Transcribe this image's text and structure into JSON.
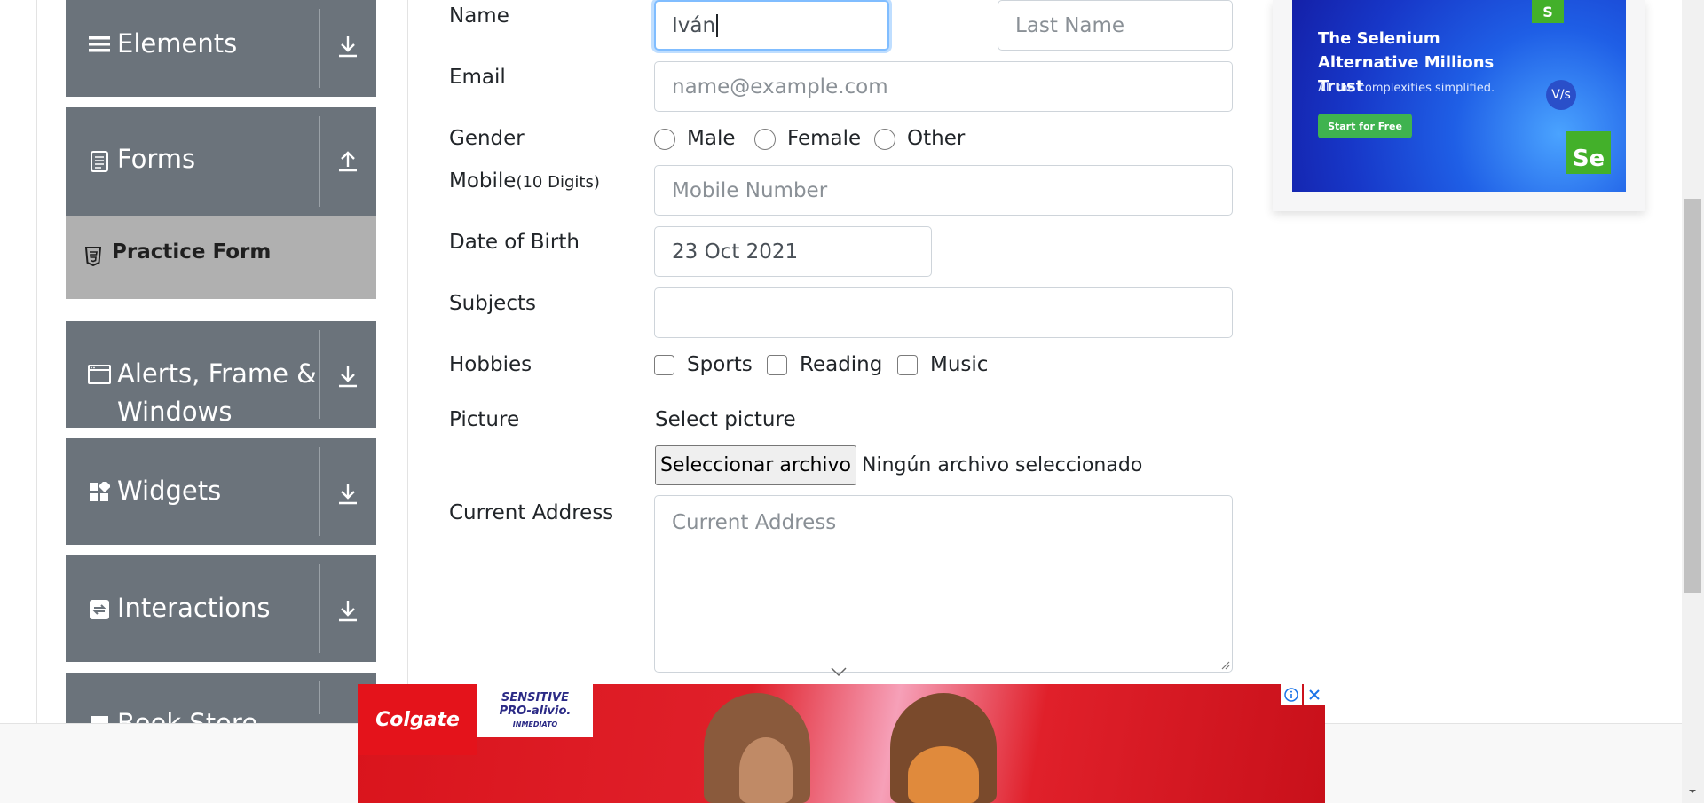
{
  "sidebar": {
    "groups": [
      {
        "label": "Elements",
        "icon": "hamburger-icon",
        "arrow": "download-arrow-icon"
      },
      {
        "label": "Forms",
        "icon": "document-icon",
        "arrow": "upload-arrow-icon"
      },
      {
        "label_line1": "Alerts, Frame &",
        "label_line2": "Windows",
        "icon": "window-icon",
        "arrow": "download-arrow-icon"
      },
      {
        "label": "Widgets",
        "icon": "widgets-icon",
        "arrow": "download-arrow-icon"
      },
      {
        "label": "Interactions",
        "icon": "interactions-icon",
        "arrow": "download-arrow-icon"
      },
      {
        "label": "Book Store",
        "icon": "book-icon",
        "arrow": "download-arrow-icon"
      }
    ],
    "active_item": {
      "label": "Practice Form",
      "icon": "html5-icon"
    }
  },
  "form": {
    "name_label": "Name",
    "first_name_value": "Iván",
    "last_name_placeholder": "Last Name",
    "email_label": "Email",
    "email_placeholder": "name@example.com",
    "gender_label": "Gender",
    "gender_options": [
      "Male",
      "Female",
      "Other"
    ],
    "mobile_label": "Mobile",
    "mobile_hint": "(10 Digits)",
    "mobile_placeholder": "Mobile Number",
    "dob_label": "Date of Birth",
    "dob_value": "23 Oct 2021",
    "subjects_label": "Subjects",
    "subjects_value": "",
    "hobbies_label": "Hobbies",
    "hobbies_options": [
      "Sports",
      "Reading",
      "Music"
    ],
    "picture_label": "Picture",
    "select_picture_text": "Select picture",
    "file_button_label": "Seleccionar archivo",
    "file_status": "Ningún archivo seleccionado",
    "address_label": "Current Address",
    "address_placeholder": "Current Address"
  },
  "ad_right": {
    "headline": "The Selenium Alternative Millions Trust",
    "subline": "All the complexities simplified.",
    "cta": "Start for Free",
    "badge_s": "S",
    "badge_vs": "V/s",
    "badge_se": "Se",
    "bg_color": "#1737c8",
    "cta_color": "#3fb34f"
  },
  "ad_bottom": {
    "brand": "Colgate",
    "product_line1": "SENSITIVE",
    "product_line2": "PRO-alivio.",
    "product_line3": "INMEDIATO",
    "info_icon": "info-icon",
    "close_icon": "close-icon",
    "bg_color": "#d9141c"
  },
  "colors": {
    "sidebar_group": "#6b737b",
    "sidebar_active": "#b0b0b0",
    "focus_border": "#80bdff"
  }
}
